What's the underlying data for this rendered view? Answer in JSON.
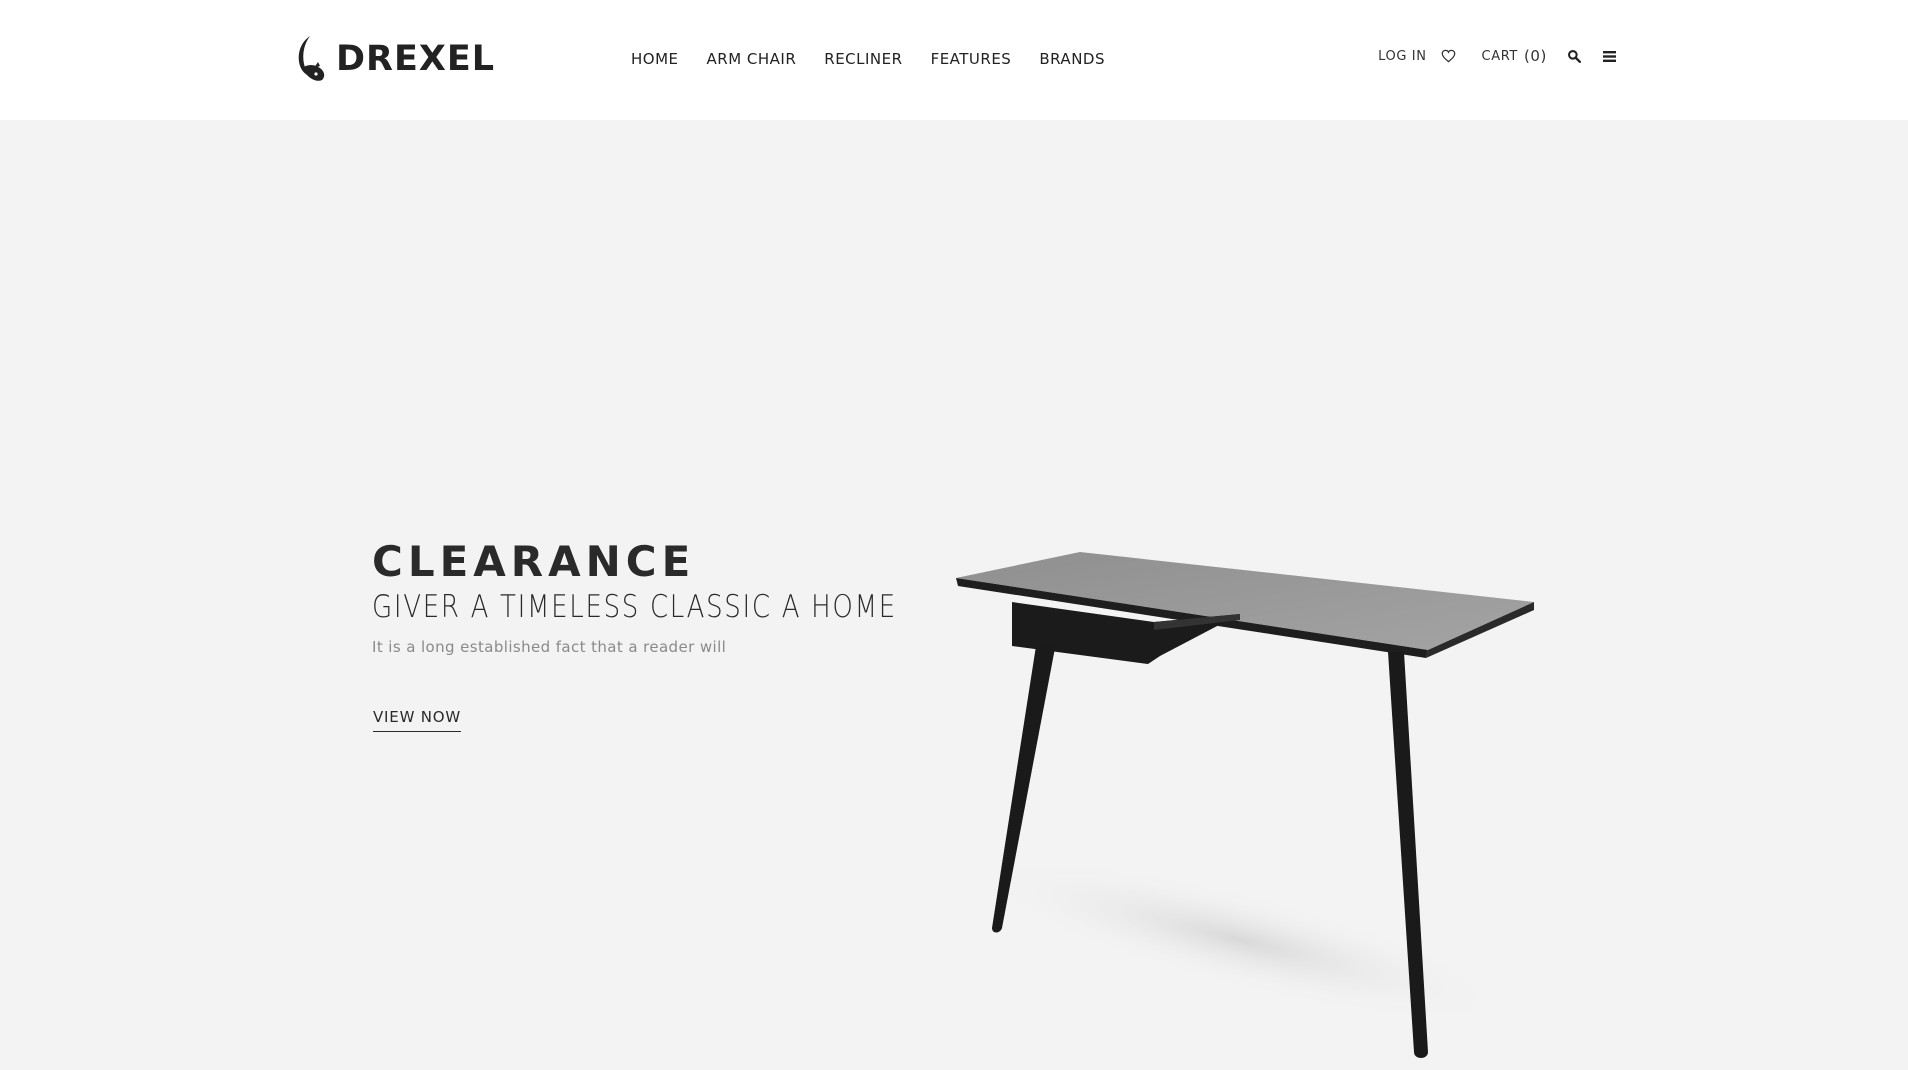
{
  "brand": {
    "name": "DREXEL"
  },
  "nav": {
    "items": [
      {
        "label": "HOME"
      },
      {
        "label": "ARM CHAIR"
      },
      {
        "label": "RECLINER"
      },
      {
        "label": "FEATURES"
      },
      {
        "label": "BRANDS"
      }
    ]
  },
  "utility": {
    "login_label": "LOG IN",
    "cart_label": "CART",
    "cart_count": "(0)",
    "icons": [
      "heart-icon",
      "search-icon",
      "menu-icon"
    ]
  },
  "hero": {
    "title": "CLEARANCE",
    "subtitle": "GIVER A TIMELESS CLASSIC A HOME",
    "description": "It is a long established fact that a reader will",
    "cta_label": "VIEW NOW"
  },
  "colors": {
    "header_bg": "#ffffff",
    "hero_bg": "#f3f3f3",
    "text_dark": "#2a2a2a",
    "text_muted": "#8a8a8a"
  }
}
